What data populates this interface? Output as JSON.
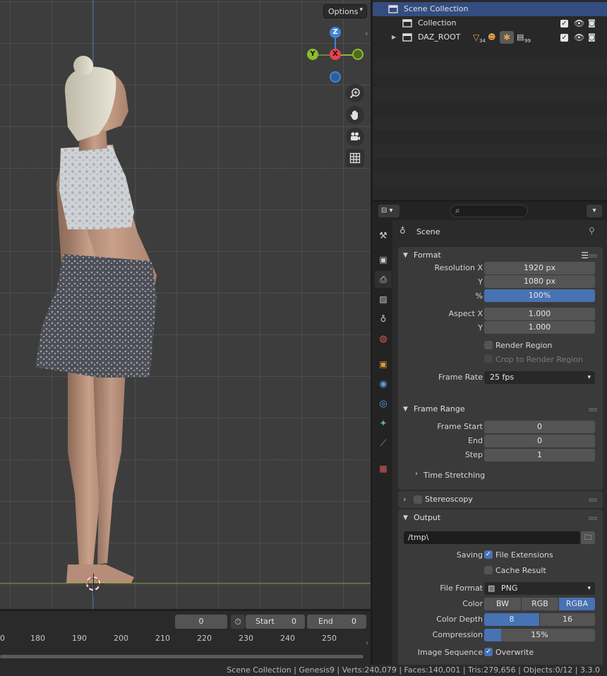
{
  "viewport": {
    "options_label": "Options",
    "gizmo": {
      "z": "Z",
      "y": "Y",
      "x": "X"
    }
  },
  "timeline": {
    "current_frame": "0",
    "start_label": "Start",
    "start_value": "0",
    "end_label": "End",
    "end_value": "0",
    "ruler": [
      "0",
      "180",
      "190",
      "200",
      "210",
      "220",
      "230",
      "240",
      "250"
    ]
  },
  "outliner": {
    "rows": [
      {
        "label": "Scene Collection"
      },
      {
        "label": "Collection"
      },
      {
        "label": "DAZ_ROOT",
        "badge1": "34",
        "badge2": "99"
      }
    ]
  },
  "properties": {
    "context_title": "Scene",
    "search_placeholder": "",
    "tabs": [
      "tool-tab",
      "render-tab",
      "output-tab",
      "view-layer-tab",
      "scene-tab",
      "world-tab",
      "object-tab",
      "modifiers-tab",
      "particles-tab",
      "physics-tab",
      "constraints-tab",
      "data-tab",
      "texture-tab"
    ],
    "format": {
      "title": "Format",
      "resolution_x_label": "Resolution X",
      "resolution_x": "1920 px",
      "resolution_y_label": "Y",
      "resolution_y": "1080 px",
      "percent_label": "%",
      "percent": "100%",
      "aspect_x_label": "Aspect X",
      "aspect_x": "1.000",
      "aspect_y_label": "Y",
      "aspect_y": "1.000",
      "render_region": "Render Region",
      "crop_region": "Crop to Render Region",
      "frame_rate_label": "Frame Rate",
      "frame_rate": "25 fps"
    },
    "frame_range": {
      "title": "Frame Range",
      "start_label": "Frame Start",
      "start": "0",
      "end_label": "End",
      "end": "0",
      "step_label": "Step",
      "step": "1",
      "time_stretching": "Time Stretching"
    },
    "stereoscopy": {
      "title": "Stereoscopy"
    },
    "output": {
      "title": "Output",
      "path": "/tmp\\",
      "saving_label": "Saving",
      "file_extensions": "File Extensions",
      "cache_result": "Cache Result",
      "file_format_label": "File Format",
      "file_format": "PNG",
      "color_label": "Color",
      "color_bw": "BW",
      "color_rgb": "RGB",
      "color_rgba": "RGBA",
      "color_depth_label": "Color Depth",
      "depth_8": "8",
      "depth_16": "16",
      "compression_label": "Compression",
      "compression": "15%",
      "compression_value": 0.15,
      "image_sequence_label": "Image Sequence",
      "overwrite": "Overwrite"
    }
  },
  "statusbar": {
    "text": "Scene Collection | Genesis9 | Verts:240,079 | Faces:140,001 | Tris:279,656 | Objects:0/12 | 3.3.0"
  },
  "colors": {
    "accent": "#4772b3",
    "selection": "#334d80",
    "axis_x": "#e8424f",
    "axis_y": "#8cbb2d",
    "axis_z": "#3f85d6"
  }
}
